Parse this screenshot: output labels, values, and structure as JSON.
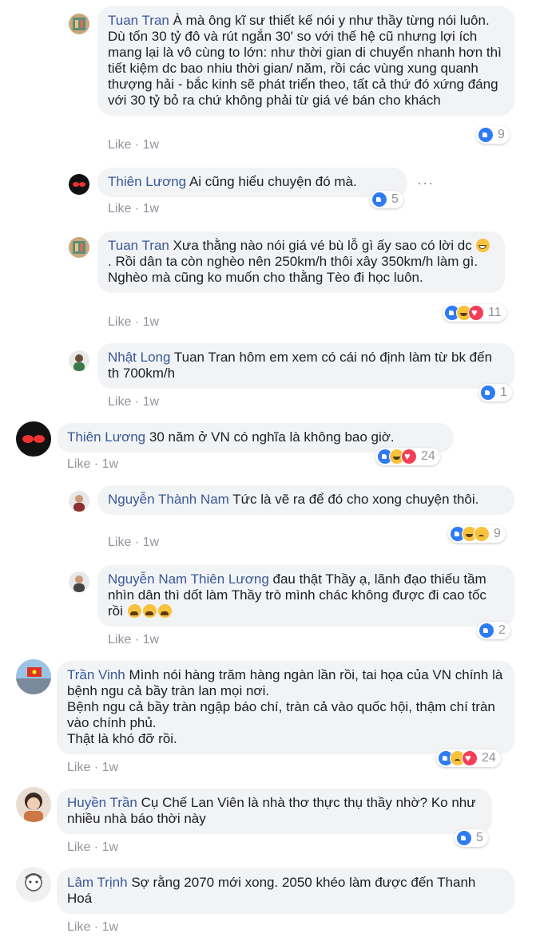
{
  "comments": [
    {
      "author": "Tuan Tran",
      "text": "À mà ông kĩ sư thiết kế nói y như thầy từng nói luôn. Dù tốn 30 tỷ đô và rút ngắn 30' so với thế hệ cũ nhưng lợi ích mang lại là vô cùng to lớn: như thời gian di chuyển nhanh hơn thì tiết kiệm dc bao nhiu thời gian/ năm, rồi các vùng xung quanh thượng hải - bắc kinh sẽ phát triển theo, tất cả thứ đó xứng đáng với 30 tỷ bỏ ra chứ không phải từ giá vé bán cho khách",
      "like": "Like",
      "time": "1w",
      "reactions": "9"
    },
    {
      "author": "Thiên Lương",
      "text": "Ai cũng hiểu chuyện đó mà.",
      "like": "Like",
      "time": "1w",
      "reactions": "5",
      "more": "···"
    },
    {
      "author": "Tuan Tran",
      "text": "Xưa thằng nào nói giá vé bù lỗ gì ấy sao có lời dc",
      "text2": ". Rồi dân ta còn nghèo nên 250km/h thôi xây 350km/h làm gì. Nghèo mà cũng ko muốn cho thằng Tèo đi học luôn.",
      "like": "Like",
      "time": "1w",
      "reactions": "11"
    },
    {
      "author": "Nhật Long",
      "text": "Tuan Tran hôm em xem có cái nó định làm từ bk đến th 700km/h",
      "like": "Like",
      "time": "1w",
      "reactions": "1"
    },
    {
      "author": "Thiên Lương",
      "text": "30 năm ở VN có nghĩa là không bao giờ.",
      "like": "Like",
      "time": "1w",
      "reactions": "24"
    },
    {
      "author": "Nguyễn Thành Nam",
      "text": "Tức là vẽ ra để đó cho xong chuyện thôi.",
      "like": "Like",
      "time": "1w",
      "reactions": "9"
    },
    {
      "author": "Nguyễn Nam",
      "mention": "Thiên Lương",
      "text": "đau thật Thầy ạ, lãnh đạo thiếu tầm nhìn dân thì dốt làm Thầy trò mình chác không được đi cao tốc rồi",
      "like": "Like",
      "time": "1w",
      "reactions": "2"
    },
    {
      "author": "Trần Vinh",
      "text": "Mình nói hàng trăm hàng ngàn lần rồi, tai họa của VN chính là bệnh ngu cả bầy tràn lan mọi nơi.",
      "text2": "Bệnh ngu cả bầy tràn ngập báo chí, tràn cả vào quốc hội, thậm chí tràn vào chính phủ.",
      "text3": "Thật là khó đỡ rồi.",
      "like": "Like",
      "time": "1w",
      "reactions": "24"
    },
    {
      "author": "Huyền Trần",
      "text": "Cụ Chế Lan Viên là nhà thơ thực thụ thầy nhờ? Ko như nhiều nhà báo thời này",
      "like": "Like",
      "time": "1w",
      "reactions": "5"
    },
    {
      "author": "Lâm Trịnh",
      "text": "Sợ rằng 2070 mới xong. 2050 khéo làm được đến Thanh Hoá",
      "like": "Like",
      "time": "1w"
    }
  ]
}
